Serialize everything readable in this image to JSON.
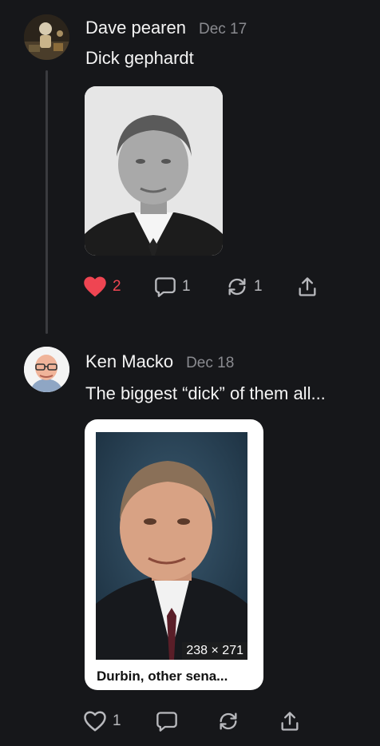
{
  "posts": [
    {
      "author": "Dave pearen",
      "date": "Dec 17",
      "text": "Dick gephardt",
      "likes": "2",
      "replies": "1",
      "reposts": "1",
      "liked": true
    },
    {
      "author": "Ken Macko",
      "date": "Dec 18",
      "text": "The biggest “dick” of them all...",
      "likes": "1",
      "replies": "",
      "reposts": "",
      "liked": false,
      "embed": {
        "dimensions": "238 × 271",
        "caption": "Durbin, other sena..."
      }
    }
  ],
  "colors": {
    "background": "#16171a",
    "like_active": "#ef4552",
    "muted": "#8a8b90"
  },
  "icons": [
    "heart-icon",
    "reply-icon",
    "repost-icon",
    "share-icon"
  ]
}
